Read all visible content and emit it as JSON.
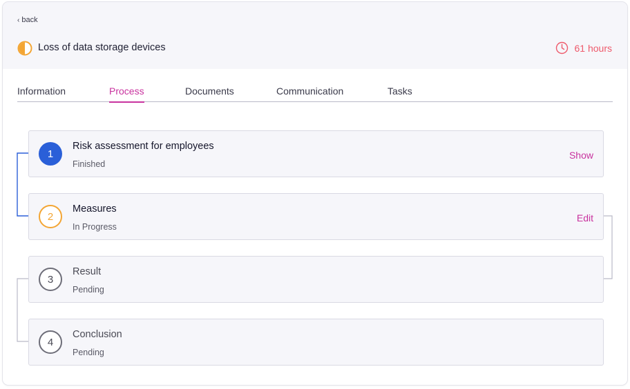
{
  "nav": {
    "back_label": "back"
  },
  "incident": {
    "title": "Loss of data storage devices",
    "time_remaining": "61 hours"
  },
  "tabs": [
    {
      "label": "Information",
      "active": false
    },
    {
      "label": "Process",
      "active": true
    },
    {
      "label": "Documents",
      "active": false
    },
    {
      "label": "Communication",
      "active": false
    },
    {
      "label": "Tasks",
      "active": false
    }
  ],
  "steps": [
    {
      "number": "1",
      "title": "Risk assessment for employees",
      "status": "Finished",
      "action": "Show",
      "state": "done"
    },
    {
      "number": "2",
      "title": "Measures",
      "status": "In Progress",
      "action": "Edit",
      "state": "progress"
    },
    {
      "number": "3",
      "title": "Result",
      "status": "Pending",
      "action": "",
      "state": "pending"
    },
    {
      "number": "4",
      "title": "Conclusion",
      "status": "Pending",
      "action": "",
      "state": "pending"
    }
  ],
  "colors": {
    "accent": "#c8329e",
    "done": "#2a5fd8",
    "in_progress": "#f3a533",
    "pending": "#6d6d78",
    "timer": "#ee5a6b"
  },
  "icons": {
    "status": "half-circle-icon",
    "timer": "clock-icon",
    "back": "chevron-left-icon"
  }
}
